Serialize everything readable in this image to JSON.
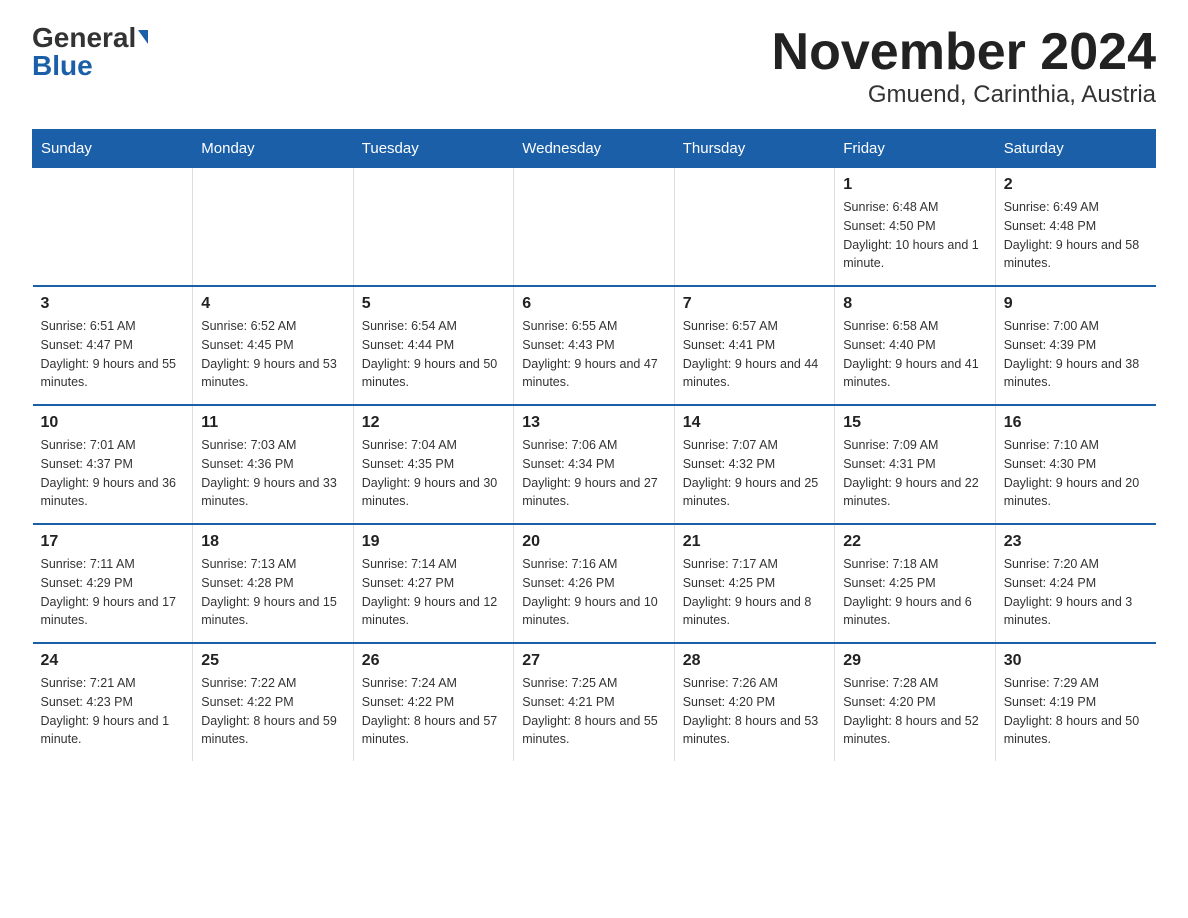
{
  "header": {
    "logo_general": "General",
    "logo_blue": "Blue",
    "title": "November 2024",
    "subtitle": "Gmuend, Carinthia, Austria"
  },
  "days_of_week": [
    "Sunday",
    "Monday",
    "Tuesday",
    "Wednesday",
    "Thursday",
    "Friday",
    "Saturday"
  ],
  "weeks": [
    [
      {
        "day": "",
        "info": ""
      },
      {
        "day": "",
        "info": ""
      },
      {
        "day": "",
        "info": ""
      },
      {
        "day": "",
        "info": ""
      },
      {
        "day": "",
        "info": ""
      },
      {
        "day": "1",
        "info": "Sunrise: 6:48 AM\nSunset: 4:50 PM\nDaylight: 10 hours and 1 minute."
      },
      {
        "day": "2",
        "info": "Sunrise: 6:49 AM\nSunset: 4:48 PM\nDaylight: 9 hours and 58 minutes."
      }
    ],
    [
      {
        "day": "3",
        "info": "Sunrise: 6:51 AM\nSunset: 4:47 PM\nDaylight: 9 hours and 55 minutes."
      },
      {
        "day": "4",
        "info": "Sunrise: 6:52 AM\nSunset: 4:45 PM\nDaylight: 9 hours and 53 minutes."
      },
      {
        "day": "5",
        "info": "Sunrise: 6:54 AM\nSunset: 4:44 PM\nDaylight: 9 hours and 50 minutes."
      },
      {
        "day": "6",
        "info": "Sunrise: 6:55 AM\nSunset: 4:43 PM\nDaylight: 9 hours and 47 minutes."
      },
      {
        "day": "7",
        "info": "Sunrise: 6:57 AM\nSunset: 4:41 PM\nDaylight: 9 hours and 44 minutes."
      },
      {
        "day": "8",
        "info": "Sunrise: 6:58 AM\nSunset: 4:40 PM\nDaylight: 9 hours and 41 minutes."
      },
      {
        "day": "9",
        "info": "Sunrise: 7:00 AM\nSunset: 4:39 PM\nDaylight: 9 hours and 38 minutes."
      }
    ],
    [
      {
        "day": "10",
        "info": "Sunrise: 7:01 AM\nSunset: 4:37 PM\nDaylight: 9 hours and 36 minutes."
      },
      {
        "day": "11",
        "info": "Sunrise: 7:03 AM\nSunset: 4:36 PM\nDaylight: 9 hours and 33 minutes."
      },
      {
        "day": "12",
        "info": "Sunrise: 7:04 AM\nSunset: 4:35 PM\nDaylight: 9 hours and 30 minutes."
      },
      {
        "day": "13",
        "info": "Sunrise: 7:06 AM\nSunset: 4:34 PM\nDaylight: 9 hours and 27 minutes."
      },
      {
        "day": "14",
        "info": "Sunrise: 7:07 AM\nSunset: 4:32 PM\nDaylight: 9 hours and 25 minutes."
      },
      {
        "day": "15",
        "info": "Sunrise: 7:09 AM\nSunset: 4:31 PM\nDaylight: 9 hours and 22 minutes."
      },
      {
        "day": "16",
        "info": "Sunrise: 7:10 AM\nSunset: 4:30 PM\nDaylight: 9 hours and 20 minutes."
      }
    ],
    [
      {
        "day": "17",
        "info": "Sunrise: 7:11 AM\nSunset: 4:29 PM\nDaylight: 9 hours and 17 minutes."
      },
      {
        "day": "18",
        "info": "Sunrise: 7:13 AM\nSunset: 4:28 PM\nDaylight: 9 hours and 15 minutes."
      },
      {
        "day": "19",
        "info": "Sunrise: 7:14 AM\nSunset: 4:27 PM\nDaylight: 9 hours and 12 minutes."
      },
      {
        "day": "20",
        "info": "Sunrise: 7:16 AM\nSunset: 4:26 PM\nDaylight: 9 hours and 10 minutes."
      },
      {
        "day": "21",
        "info": "Sunrise: 7:17 AM\nSunset: 4:25 PM\nDaylight: 9 hours and 8 minutes."
      },
      {
        "day": "22",
        "info": "Sunrise: 7:18 AM\nSunset: 4:25 PM\nDaylight: 9 hours and 6 minutes."
      },
      {
        "day": "23",
        "info": "Sunrise: 7:20 AM\nSunset: 4:24 PM\nDaylight: 9 hours and 3 minutes."
      }
    ],
    [
      {
        "day": "24",
        "info": "Sunrise: 7:21 AM\nSunset: 4:23 PM\nDaylight: 9 hours and 1 minute."
      },
      {
        "day": "25",
        "info": "Sunrise: 7:22 AM\nSunset: 4:22 PM\nDaylight: 8 hours and 59 minutes."
      },
      {
        "day": "26",
        "info": "Sunrise: 7:24 AM\nSunset: 4:22 PM\nDaylight: 8 hours and 57 minutes."
      },
      {
        "day": "27",
        "info": "Sunrise: 7:25 AM\nSunset: 4:21 PM\nDaylight: 8 hours and 55 minutes."
      },
      {
        "day": "28",
        "info": "Sunrise: 7:26 AM\nSunset: 4:20 PM\nDaylight: 8 hours and 53 minutes."
      },
      {
        "day": "29",
        "info": "Sunrise: 7:28 AM\nSunset: 4:20 PM\nDaylight: 8 hours and 52 minutes."
      },
      {
        "day": "30",
        "info": "Sunrise: 7:29 AM\nSunset: 4:19 PM\nDaylight: 8 hours and 50 minutes."
      }
    ]
  ]
}
